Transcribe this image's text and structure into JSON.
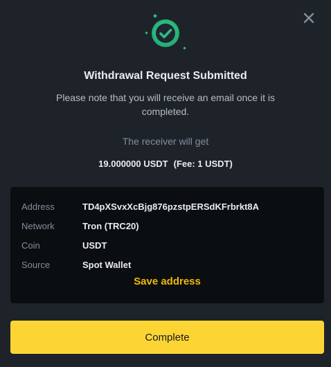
{
  "dialog": {
    "close_icon": "close-icon",
    "status_icon": "check-circle-icon",
    "title": "Withdrawal Request Submitted",
    "subtitle": "Please note that you will receive an email once it is completed.",
    "receiver_label": "The receiver will get",
    "amount": "19.000000 USDT",
    "fee": "(Fee: 1 USDT)"
  },
  "details": {
    "rows": [
      {
        "label": "Address",
        "value": "TD4pXSvxXcBjg876pzstpERSdKFrbrkt8A"
      },
      {
        "label": "Network",
        "value": "Tron (TRC20)"
      },
      {
        "label": "Coin",
        "value": "USDT"
      },
      {
        "label": "Source",
        "value": "Spot Wallet"
      }
    ],
    "save_address_label": "Save address"
  },
  "actions": {
    "complete_label": "Complete"
  },
  "colors": {
    "background": "#1e2329",
    "panel": "#0b0e11",
    "accent": "#fcd535",
    "link": "#f0b90b",
    "success": "#2ebd85"
  }
}
